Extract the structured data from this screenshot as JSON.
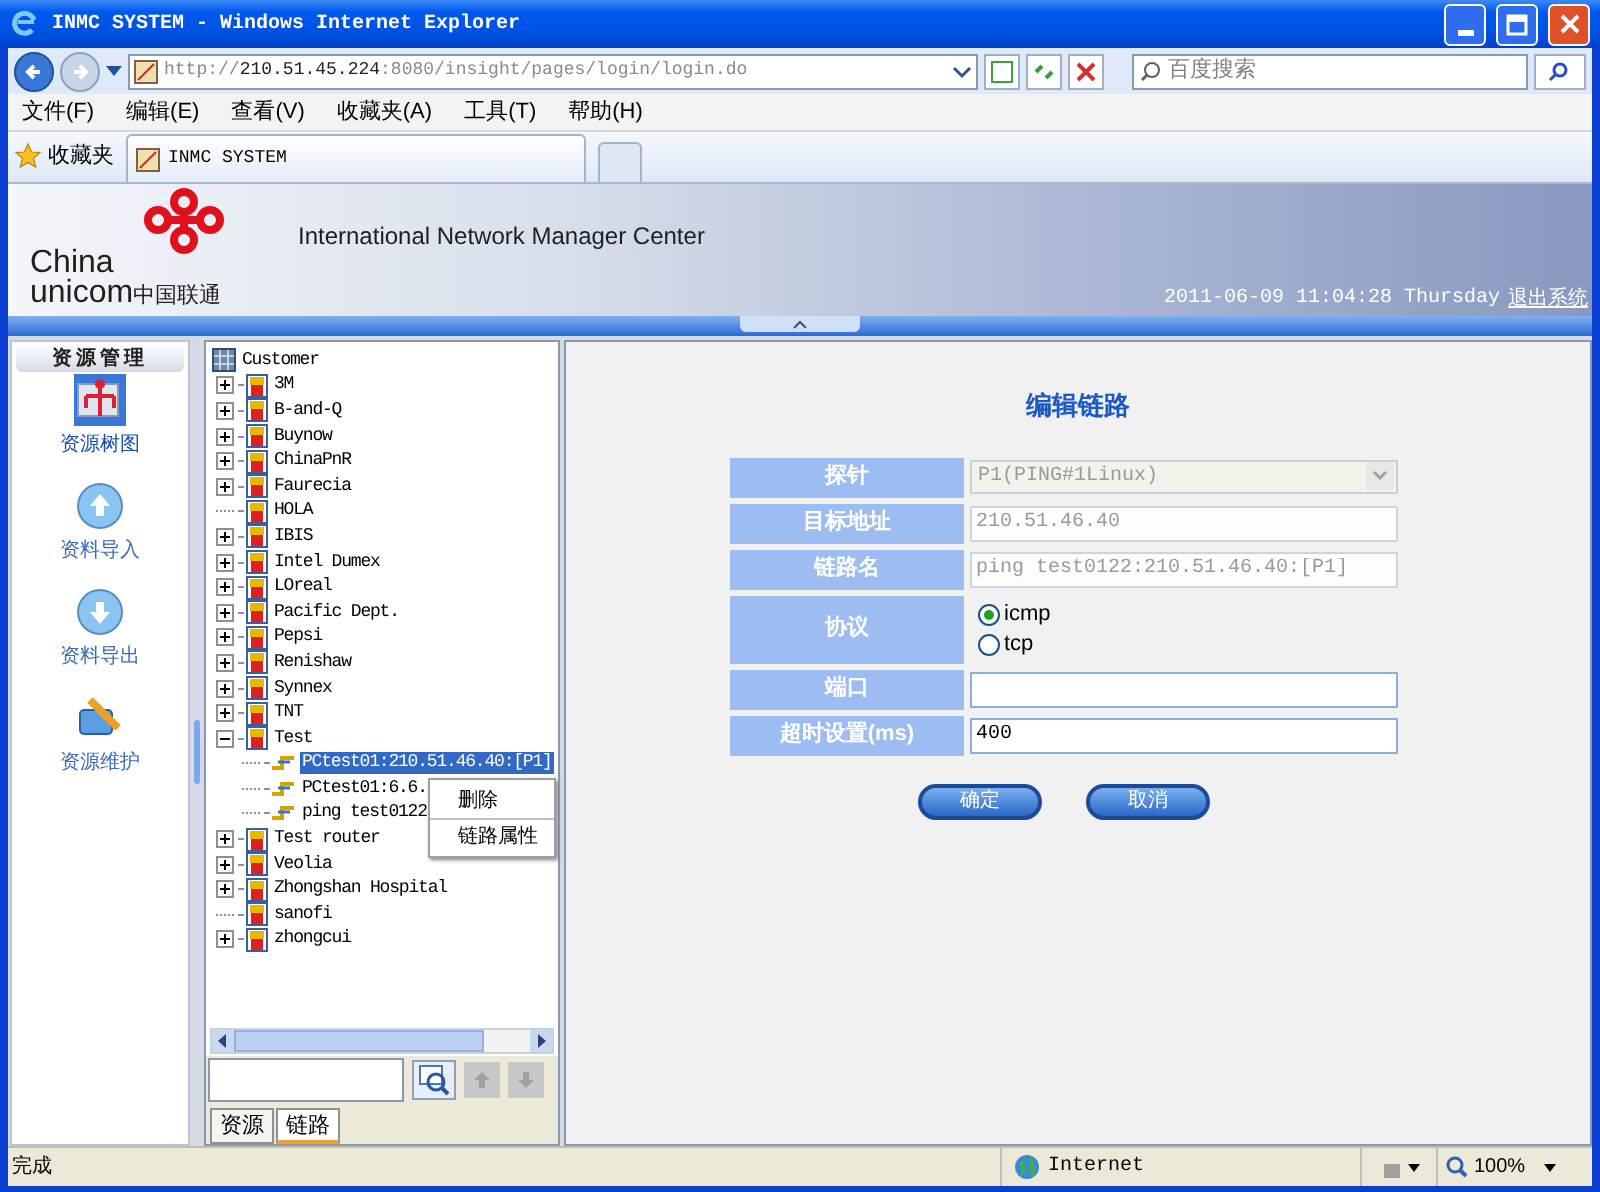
{
  "window": {
    "title": "INMC SYSTEM - Windows Internet Explorer"
  },
  "address_bar": {
    "url_scheme": "http://",
    "url_host": "210.51.45.224",
    "url_rest": ":8080/insight/pages/login/login.do"
  },
  "search_box": {
    "placeholder": "百度搜索"
  },
  "menu": [
    "文件(F)",
    "编辑(E)",
    "查看(V)",
    "收藏夹(A)",
    "工具(T)",
    "帮助(H)"
  ],
  "favorites": {
    "label": "收藏夹"
  },
  "tabs": [
    {
      "label": "INMC SYSTEM",
      "selected": true
    }
  ],
  "header": {
    "logo_en_1": "China",
    "logo_en_2": "unicom",
    "logo_cn": "中国联通",
    "title": "International Network Manager Center",
    "datetime": "2011-06-09 11:04:28 Thursday",
    "logout": "退出系统"
  },
  "sidebar": {
    "title": "资源管理",
    "items": [
      {
        "label": "资源树图",
        "kind": "tree",
        "selected": true
      },
      {
        "label": "资料导入",
        "kind": "import",
        "selected": false
      },
      {
        "label": "资料导出",
        "kind": "export",
        "selected": false
      },
      {
        "label": "资源维护",
        "kind": "maintain",
        "selected": false
      }
    ]
  },
  "tree": {
    "label": "Customer",
    "kind": "root",
    "selected": false,
    "children": [
      {
        "label": "3M",
        "kind": "customer",
        "expanded": false,
        "selected": false
      },
      {
        "label": "B-and-Q",
        "kind": "customer",
        "expanded": false,
        "selected": false
      },
      {
        "label": "Buynow",
        "kind": "customer",
        "expanded": false,
        "selected": false
      },
      {
        "label": "ChinaPnR",
        "kind": "customer",
        "expanded": false,
        "selected": false
      },
      {
        "label": "Faurecia",
        "kind": "customer",
        "expanded": false,
        "selected": false
      },
      {
        "label": "HOLA",
        "kind": "customer",
        "selected": false
      },
      {
        "label": "IBIS",
        "kind": "customer",
        "expanded": false,
        "selected": false
      },
      {
        "label": "Intel Dumex",
        "kind": "customer",
        "expanded": false,
        "selected": false
      },
      {
        "label": "LOreal",
        "kind": "customer",
        "expanded": false,
        "selected": false
      },
      {
        "label": "Pacific Dept.",
        "kind": "customer",
        "expanded": false,
        "selected": false
      },
      {
        "label": "Pepsi",
        "kind": "customer",
        "expanded": false,
        "selected": false
      },
      {
        "label": "Renishaw",
        "kind": "customer",
        "expanded": false,
        "selected": false
      },
      {
        "label": "Synnex",
        "kind": "customer",
        "expanded": false,
        "selected": false
      },
      {
        "label": "TNT",
        "kind": "customer",
        "expanded": false,
        "selected": false
      },
      {
        "label": "Test",
        "kind": "customer",
        "expanded": true,
        "selected": false,
        "children": [
          {
            "label": "PCtest01:210.51.46.40:[P1]",
            "kind": "link",
            "selected": true
          },
          {
            "label": "PCtest01:6.6.",
            "kind": "link",
            "selected": false
          },
          {
            "label": "ping test0122",
            "kind": "link",
            "selected": false
          }
        ]
      },
      {
        "label": "Test router",
        "kind": "customer",
        "expanded": false,
        "selected": false
      },
      {
        "label": "Veolia",
        "kind": "customer",
        "expanded": false,
        "selected": false
      },
      {
        "label": "Zhongshan Hospital",
        "kind": "customer",
        "expanded": false,
        "selected": false
      },
      {
        "label": "sanofi",
        "kind": "customer",
        "selected": false
      },
      {
        "label": "zhongcui",
        "kind": "customer",
        "expanded": false,
        "selected": false
      }
    ]
  },
  "context_menu": {
    "items": [
      "删除",
      "链路属性"
    ]
  },
  "tree_buttons": [
    {
      "kind": "search",
      "disabled": false
    },
    {
      "kind": "up",
      "disabled": true
    },
    {
      "kind": "down",
      "disabled": true
    }
  ],
  "bottom_tabs": [
    {
      "label": "资源",
      "selected": false
    },
    {
      "label": "链路",
      "selected": true
    }
  ],
  "form": {
    "title": "编辑链路",
    "fields": [
      {
        "label": "探针",
        "kind": "select",
        "value": "P1(PING#1Linux)",
        "disabled": true
      },
      {
        "label": "目标地址",
        "kind": "text",
        "value": "210.51.46.40",
        "disabled": true
      },
      {
        "label": "链路名",
        "kind": "text",
        "value": "ping test0122:210.51.46.40:[P1]",
        "disabled": true
      },
      {
        "label": "协议",
        "kind": "radio",
        "options": [
          {
            "label": "icmp",
            "selected": true
          },
          {
            "label": "tcp",
            "selected": false
          }
        ]
      },
      {
        "label": "端口",
        "kind": "text",
        "disabled": false
      },
      {
        "label": "超时设置(ms)",
        "kind": "text",
        "value": "400",
        "disabled": false
      }
    ],
    "buttons": [
      "确定",
      "取消"
    ]
  },
  "status_bar": {
    "text": "完成",
    "zone": "Internet",
    "zoom": "100%"
  }
}
